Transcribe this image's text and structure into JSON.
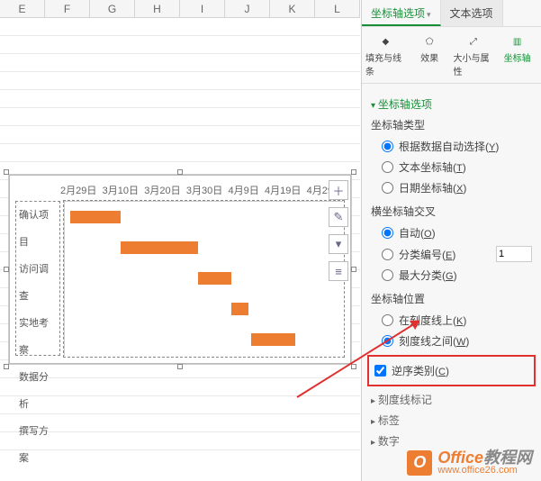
{
  "columns": [
    "E",
    "F",
    "G",
    "H",
    "I",
    "J",
    "K",
    "L"
  ],
  "tabs": {
    "axis_options": "坐标轴选项",
    "text_options": "文本选项"
  },
  "toolbar": {
    "fill_line": "填充与线条",
    "effects": "效果",
    "size_prop": "大小与属性",
    "axis": "坐标轴"
  },
  "sections": {
    "axis_options": "坐标轴选项",
    "tick_marks": "刻度线标记",
    "labels": "标签",
    "numbers": "数字"
  },
  "axis_type": {
    "title": "坐标轴类型",
    "opts": [
      {
        "label": "根据数据自动选择(",
        "key": "Y",
        "checked": true
      },
      {
        "label": "文本坐标轴(",
        "key": "T",
        "checked": false
      },
      {
        "label": "日期坐标轴(",
        "key": "X",
        "checked": false
      }
    ]
  },
  "cross": {
    "title": "横坐标轴交叉",
    "opts": [
      {
        "label": "自动(",
        "key": "O",
        "checked": true
      },
      {
        "label": "分类编号(",
        "key": "E",
        "checked": false,
        "spin": "1"
      },
      {
        "label": "最大分类(",
        "key": "G",
        "checked": false
      }
    ]
  },
  "position": {
    "title": "坐标轴位置",
    "opts": [
      {
        "label": "在刻度线上(",
        "key": "K",
        "checked": false
      },
      {
        "label": "刻度线之间(",
        "key": "W",
        "checked": true
      }
    ],
    "reverse": {
      "label": "逆序类别(",
      "key": "C",
      "checked": true
    }
  },
  "chart_data": {
    "type": "bar",
    "categories": [
      "确认项目",
      "访问调查",
      "实地考察",
      "数据分析",
      "撰写方案"
    ],
    "x_ticks": [
      "2月29日",
      "3月10日",
      "3月20日",
      "3月30日",
      "4月9日",
      "4月19日",
      "4月29日"
    ],
    "bars": [
      {
        "start_pct": 2,
        "width_pct": 18
      },
      {
        "start_pct": 20,
        "width_pct": 28
      },
      {
        "start_pct": 48,
        "width_pct": 12
      },
      {
        "start_pct": 60,
        "width_pct": 6
      },
      {
        "start_pct": 67,
        "width_pct": 16
      }
    ],
    "title": "",
    "xlabel": "",
    "ylabel": ""
  },
  "footer": {
    "brand": "Office",
    "brand2": "教程网",
    "url": "www.office26.com"
  }
}
